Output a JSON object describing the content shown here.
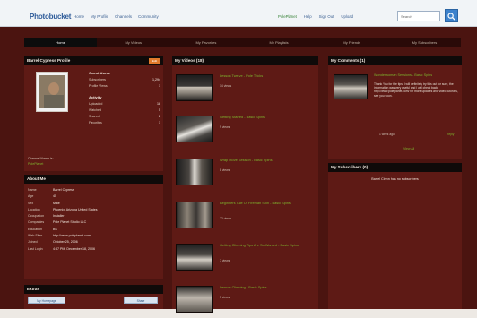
{
  "header": {
    "logo": "Photobucket",
    "nav": [
      "Home",
      "My Profile",
      "Channels",
      "Community"
    ],
    "right": {
      "user": "PolePlanet",
      "help": "Help",
      "signout": "Sign Out",
      "upload": "Upload"
    },
    "search_placeholder": "Search"
  },
  "tabs": [
    "Home",
    "My Videos",
    "My Favorites",
    "My Playlists",
    "My Friends",
    "My Subscribers"
  ],
  "profile_panel": {
    "title": "Barrel Cypress Profile",
    "edit": "Edit",
    "stats_header": "Guest Users",
    "stats": [
      {
        "label": "Subscribers",
        "value": "1,294"
      },
      {
        "label": "Profile Views",
        "value": "1"
      }
    ],
    "activity_header": "Activity",
    "activity": [
      {
        "label": "Uploaded",
        "value": "18"
      },
      {
        "label": "Watched",
        "value": "5"
      },
      {
        "label": "Shared",
        "value": "2"
      },
      {
        "label": "Favorites",
        "value": "1"
      }
    ],
    "channel_label": "Channel Name is:",
    "channel_link": "PolePlanet"
  },
  "about": {
    "title": "About Me",
    "rows": [
      {
        "k": "Name",
        "v": "Barrel Cypress"
      },
      {
        "k": "Age",
        "v": "45"
      },
      {
        "k": "Sex",
        "v": "Male"
      },
      {
        "k": "Location",
        "v": "Phoenix, Arizona United States"
      },
      {
        "k": "Occupation",
        "v": "Installer"
      },
      {
        "k": "Companies",
        "v": "Pole Planet Studio LLC"
      },
      {
        "k": "Education",
        "v": "BS"
      },
      {
        "k": "Web Sites",
        "v": "http://www.poleplanet.com",
        "link": true
      },
      {
        "k": "Joined",
        "v": "October 25, 2006"
      },
      {
        "k": "Last Login",
        "v": "4:37 PM, December 18, 2006"
      }
    ]
  },
  "extras": {
    "title": "Extras",
    "btn_left": "My Homepage",
    "btn_right": "Share"
  },
  "videos_panel": {
    "title": "My Videos (18)",
    "items": [
      {
        "title": "Lesson Twelve - Pole Tricks",
        "meta": "14 views"
      },
      {
        "title": "Getting Started - Basic Spins",
        "meta": "9 views"
      },
      {
        "title": "Wrap Move Session - Basic Spins",
        "meta": "8 views"
      },
      {
        "title": "Beginners Tale Of Fireman Spin - Basic Spins",
        "meta": "22 views"
      },
      {
        "title": "Getting Climbing Tips Are So Wanted - Basic Spins",
        "meta": "7 views"
      },
      {
        "title": "Lesson Climbing - Basic Spins",
        "meta": "5 views"
      }
    ]
  },
  "comments_panel": {
    "title": "My Comments (1)",
    "comment": {
      "title": "Wonderwoman Sessions - Basic Spins",
      "body": "Thank You for the tips, I will definitely try this out for sure, the information was very useful and I will check back http://www.poleplanet.com/ for more updates and video tutorials, see you soon.",
      "date": "1 week ago",
      "reply": "Reply",
      "view_all": "View All"
    }
  },
  "subscribers_panel": {
    "title": "My Subscribers (0)",
    "text": "Barrel Cinnn has no subscribers"
  }
}
